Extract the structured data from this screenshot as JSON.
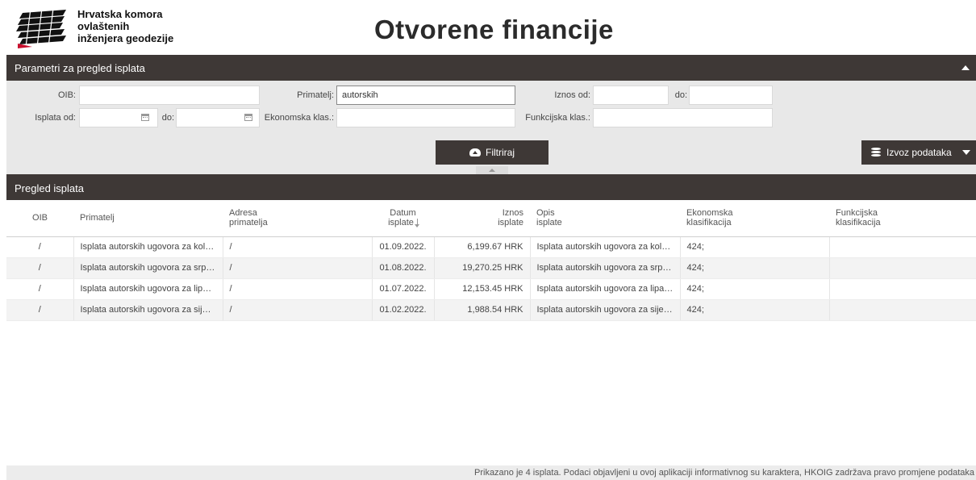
{
  "header": {
    "org_name": [
      "Hrvatska komora",
      "ovlaštenih",
      "inženjera geodezije"
    ],
    "title": "Otvorene financije"
  },
  "params": {
    "section_title": "Parametri za pregled isplata",
    "oib_label": "OIB:",
    "oib_value": "",
    "primatelj_label": "Primatelj:",
    "primatelj_value": "autorskih",
    "iznos_od_label": "Iznos od:",
    "iznos_od_value": "",
    "iznos_do_label": "do:",
    "iznos_do_value": "",
    "isplata_od_label": "Isplata od:",
    "isplata_od_value": "",
    "isplata_do_label": "do:",
    "isplata_do_value": "",
    "ekonomska_label": "Ekonomska klas.:",
    "ekonomska_value": "",
    "funkcijska_label": "Funkcijska klas.:",
    "funkcijska_value": "",
    "filter_button": "Filtriraj",
    "export_button": "Izvoz podataka"
  },
  "table": {
    "section_title": "Pregled isplata",
    "columns": {
      "oib": "OIB",
      "primatelj": "Primatelj",
      "adresa": [
        "Adresa",
        "primatelja"
      ],
      "datum": [
        "Datum",
        "isplate"
      ],
      "iznos": [
        "Iznos",
        "isplate"
      ],
      "opis": [
        "Opis",
        "isplate"
      ],
      "ekonomska": [
        "Ekonomska",
        "klasifikacija"
      ],
      "funkcijska": [
        "Funkcijska",
        "klasifikacija"
      ]
    },
    "rows": [
      {
        "oib": "/",
        "primatelj": "Isplata autorskih ugovora za kolo…",
        "adresa": "/",
        "datum": "01.09.2022.",
        "iznos": "6,199.67 HRK",
        "opis": "Isplata autorskih ugovora za kolo…",
        "ekonomska": "424;",
        "funkcijska": ""
      },
      {
        "oib": "/",
        "primatelj": "Isplata autorskih ugovora za srpa…",
        "adresa": "/",
        "datum": "01.08.2022.",
        "iznos": "19,270.25 HRK",
        "opis": "Isplata autorskih ugovora za srpa…",
        "ekonomska": "424;",
        "funkcijska": ""
      },
      {
        "oib": "/",
        "primatelj": "Isplata autorskih ugovora za lipan…",
        "adresa": "/",
        "datum": "01.07.2022.",
        "iznos": "12,153.45 HRK",
        "opis": "Isplata autorskih ugovora za lipa…",
        "ekonomska": "424;",
        "funkcijska": ""
      },
      {
        "oib": "/",
        "primatelj": "Isplata autorskih ugovora za siječ…",
        "adresa": "/",
        "datum": "01.02.2022.",
        "iznos": "1,988.54 HRK",
        "opis": "Isplata autorskih ugovora za siječ…",
        "ekonomska": "424;",
        "funkcijska": ""
      }
    ]
  },
  "footer": {
    "text": "Prikazano je 4 isplata. Podaci objavljeni u ovoj aplikaciji informativnog su karaktera, HKOIG zadržava pravo promjene podataka"
  }
}
